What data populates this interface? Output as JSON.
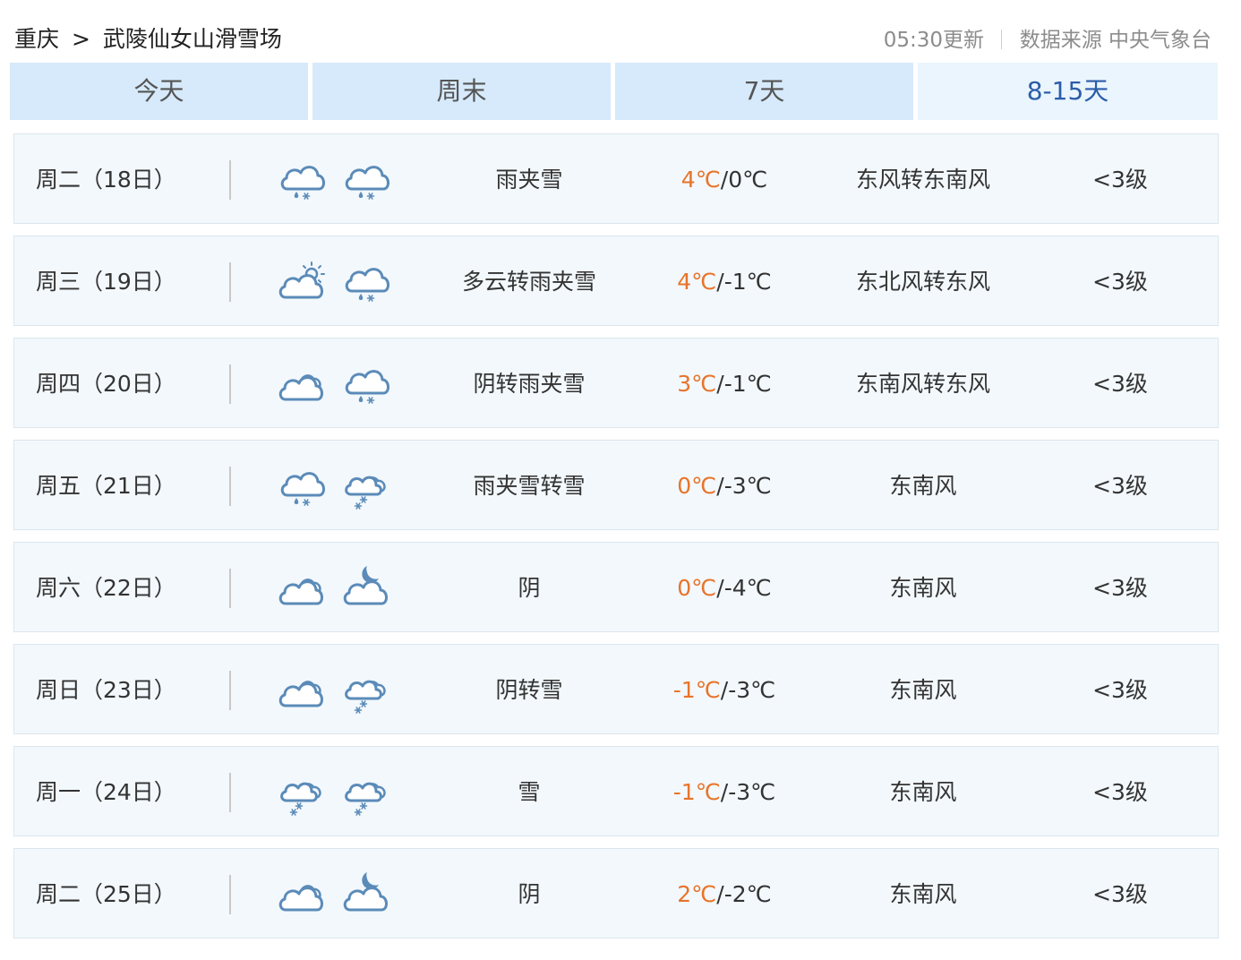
{
  "breadcrumb": {
    "city": "重庆",
    "separator": ">",
    "place": "武陵仙女山滑雪场"
  },
  "meta": {
    "update_time": "05:30更新",
    "source": "数据来源 中央气象台"
  },
  "tabs": [
    {
      "label": "今天"
    },
    {
      "label": "周末"
    },
    {
      "label": "7天"
    },
    {
      "label": "8-15天",
      "active": true
    }
  ],
  "colors": {
    "high_temp": "#e8742a",
    "active_tab_text": "#2b5da8",
    "tab_bg": "#d6eafb",
    "row_bg": "#f3f8fc",
    "icon_stroke": "#5b8bb8"
  },
  "forecast": [
    {
      "day": "周二（18日）",
      "icon_day": "sleet",
      "icon_night": "sleet",
      "condition": "雨夹雪",
      "high": "4℃",
      "low": "/0℃",
      "wind": "东风转东南风",
      "level": "<3级"
    },
    {
      "day": "周三（19日）",
      "icon_day": "partly-cloudy",
      "icon_night": "sleet",
      "condition": "多云转雨夹雪",
      "high": "4℃",
      "low": "/-1℃",
      "wind": "东北风转东风",
      "level": "<3级"
    },
    {
      "day": "周四（20日）",
      "icon_day": "overcast",
      "icon_night": "sleet",
      "condition": "阴转雨夹雪",
      "high": "3℃",
      "low": "/-1℃",
      "wind": "东南风转东风",
      "level": "<3级"
    },
    {
      "day": "周五（21日）",
      "icon_day": "sleet",
      "icon_night": "snow",
      "condition": "雨夹雪转雪",
      "high": "0℃",
      "low": "/-3℃",
      "wind": "东南风",
      "level": "<3级"
    },
    {
      "day": "周六（22日）",
      "icon_day": "overcast",
      "icon_night": "cloudy-night",
      "condition": "阴",
      "high": "0℃",
      "low": "/-4℃",
      "wind": "东南风",
      "level": "<3级"
    },
    {
      "day": "周日（23日）",
      "icon_day": "overcast",
      "icon_night": "snow",
      "condition": "阴转雪",
      "high": "-1℃",
      "low": "/-3℃",
      "wind": "东南风",
      "level": "<3级"
    },
    {
      "day": "周一（24日）",
      "icon_day": "snow",
      "icon_night": "snow",
      "condition": "雪",
      "high": "-1℃",
      "low": "/-3℃",
      "wind": "东南风",
      "level": "<3级"
    },
    {
      "day": "周二（25日）",
      "icon_day": "overcast",
      "icon_night": "cloudy-night",
      "condition": "阴",
      "high": "2℃",
      "low": "/-2℃",
      "wind": "东南风",
      "level": "<3级"
    }
  ]
}
